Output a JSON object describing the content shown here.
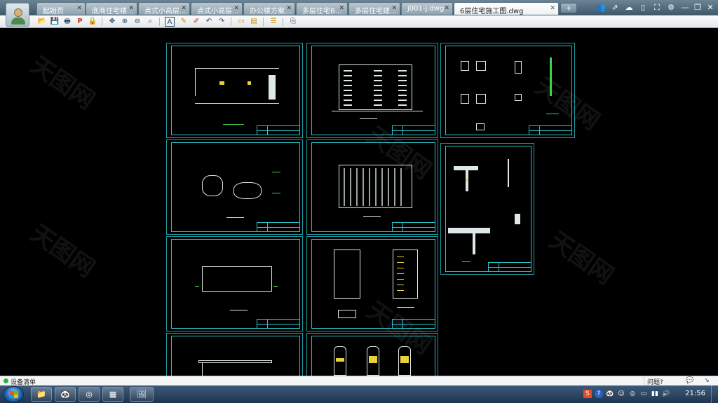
{
  "tabs": [
    {
      "label": "起始页",
      "active": false
    },
    {
      "label": "底商住宅楼...",
      "active": false
    },
    {
      "label": "点式小高层...",
      "active": false
    },
    {
      "label": "点式小高层...",
      "active": false
    },
    {
      "label": "办公楼方案...",
      "active": false
    },
    {
      "label": "多层住宅B...",
      "active": false
    },
    {
      "label": "多层住宅建...",
      "active": false
    },
    {
      "label": "j001-j.dwg",
      "active": false
    },
    {
      "label": "6层住宅施工图.dwg",
      "active": true
    }
  ],
  "tab_close_glyph": "✕",
  "new_tab_glyph": "+",
  "window_buttons": [
    {
      "name": "user-icon",
      "glyph": "👥"
    },
    {
      "name": "share-icon",
      "glyph": "⇗"
    },
    {
      "name": "cloud-icon",
      "glyph": "☁"
    },
    {
      "name": "phone-icon",
      "glyph": "▯"
    },
    {
      "name": "fullscreen-icon",
      "glyph": "⛶"
    },
    {
      "name": "settings-icon",
      "glyph": "⚙"
    },
    {
      "name": "minimize-icon",
      "glyph": "—"
    },
    {
      "name": "restore-icon",
      "glyph": "❐"
    },
    {
      "name": "close-icon",
      "glyph": "✕"
    }
  ],
  "toolbar": [
    {
      "name": "open-icon",
      "glyph": "📂"
    },
    {
      "name": "save-icon",
      "glyph": "💾"
    },
    {
      "name": "print-icon",
      "glyph": "🖶"
    },
    {
      "name": "pdf-icon",
      "glyph": "P"
    },
    {
      "name": "lock-icon",
      "glyph": "🔒"
    },
    {
      "name": "pan-icon",
      "glyph": "✥"
    },
    {
      "name": "zoom-in-icon",
      "glyph": "⊕"
    },
    {
      "name": "zoom-out-icon",
      "glyph": "⊖"
    },
    {
      "name": "zoom-window-icon",
      "glyph": "⌕"
    },
    {
      "name": "text-icon",
      "glyph": "A"
    },
    {
      "name": "pencil-icon",
      "glyph": "✎"
    },
    {
      "name": "highlight-icon",
      "glyph": "✐"
    },
    {
      "name": "undo-icon",
      "glyph": "↶"
    },
    {
      "name": "redo-icon",
      "glyph": "↷"
    },
    {
      "name": "measure-icon",
      "glyph": "▭"
    },
    {
      "name": "area-icon",
      "glyph": "▤"
    },
    {
      "name": "layers-icon",
      "glyph": "☰"
    },
    {
      "name": "export-icon",
      "glyph": "⎘"
    }
  ],
  "watermark": "天图网",
  "status": {
    "left_label": "设备清单",
    "help_label": "问题?",
    "btn1": "💬",
    "btn2": "↘"
  },
  "taskbar": {
    "apps": [
      "📁",
      "🐼",
      "◎",
      "▦",
      "🖼"
    ],
    "tray": [
      "S",
      "?",
      "🐼",
      "☺",
      "◎",
      "▭",
      "▮▮",
      "🔊"
    ],
    "clock": "21:56"
  },
  "colors": {
    "frame": "#28c4cc",
    "line": "#dfe8e8",
    "dim": "#38d64a",
    "highlight": "#e6d23a"
  }
}
